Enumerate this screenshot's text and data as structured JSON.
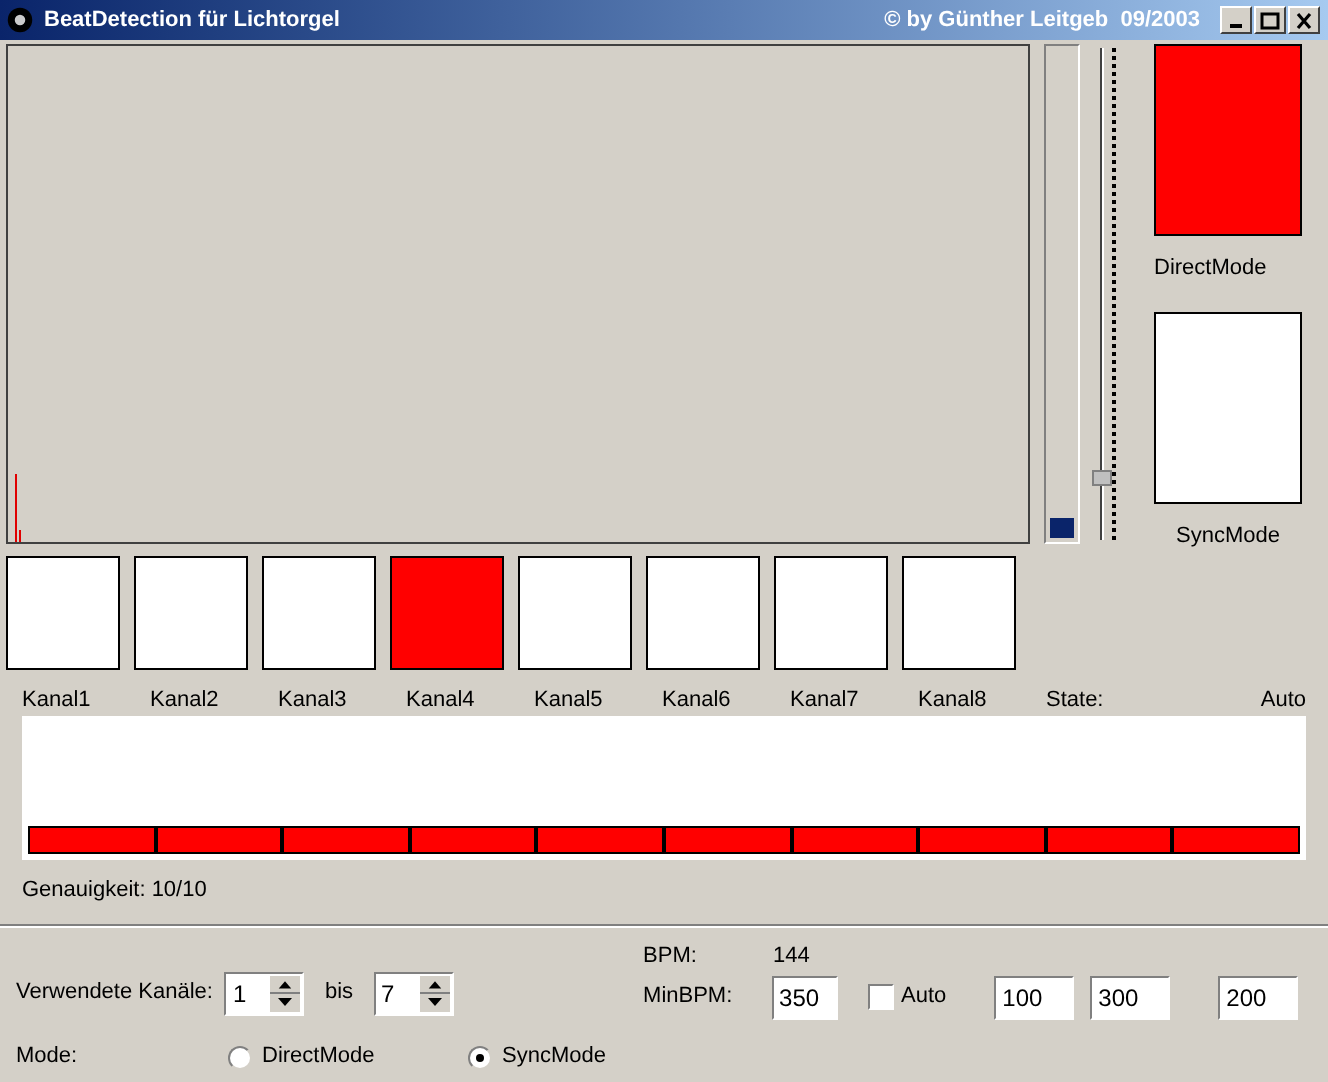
{
  "window": {
    "title": "BeatDetection für Lichtorgel",
    "credit": "© by Günther Leitgeb  09/2003"
  },
  "input_meter": {
    "level": 0.04
  },
  "sensitivity_slider": {
    "level": 0.12
  },
  "mode_indicators": [
    {
      "label": "DirectMode",
      "on": true
    },
    {
      "label": "SyncMode",
      "on": false
    }
  ],
  "channels": [
    {
      "label": "Kanal1",
      "on": false
    },
    {
      "label": "Kanal2",
      "on": false
    },
    {
      "label": "Kanal3",
      "on": false
    },
    {
      "label": "Kanal4",
      "on": true
    },
    {
      "label": "Kanal5",
      "on": false
    },
    {
      "label": "Kanal6",
      "on": false
    },
    {
      "label": "Kanal7",
      "on": false
    },
    {
      "label": "Kanal8",
      "on": false
    }
  ],
  "state": {
    "label": "State:",
    "value": "Auto"
  },
  "accuracy_bars": [
    {
      "on": true
    },
    {
      "on": true
    },
    {
      "on": true
    },
    {
      "on": true
    },
    {
      "on": true
    },
    {
      "on": true
    },
    {
      "on": true
    },
    {
      "on": true
    },
    {
      "on": true
    },
    {
      "on": true
    }
  ],
  "accuracy_text": "Genauigkeit: 10/10",
  "channel_range": {
    "label": "Verwendete Kanäle:",
    "from": "1",
    "separator": "bis",
    "to": "7"
  },
  "bpm": {
    "label": "BPM:",
    "value": "144"
  },
  "min_bpm": {
    "label": "MinBPM:",
    "value": "350",
    "auto_label": "Auto",
    "auto_checked": false,
    "fields": [
      "100",
      "300",
      "200"
    ]
  },
  "mode": {
    "label": "Mode:",
    "options": [
      {
        "label": "DirectMode",
        "selected": false
      },
      {
        "label": "SyncMode",
        "selected": true
      }
    ]
  }
}
